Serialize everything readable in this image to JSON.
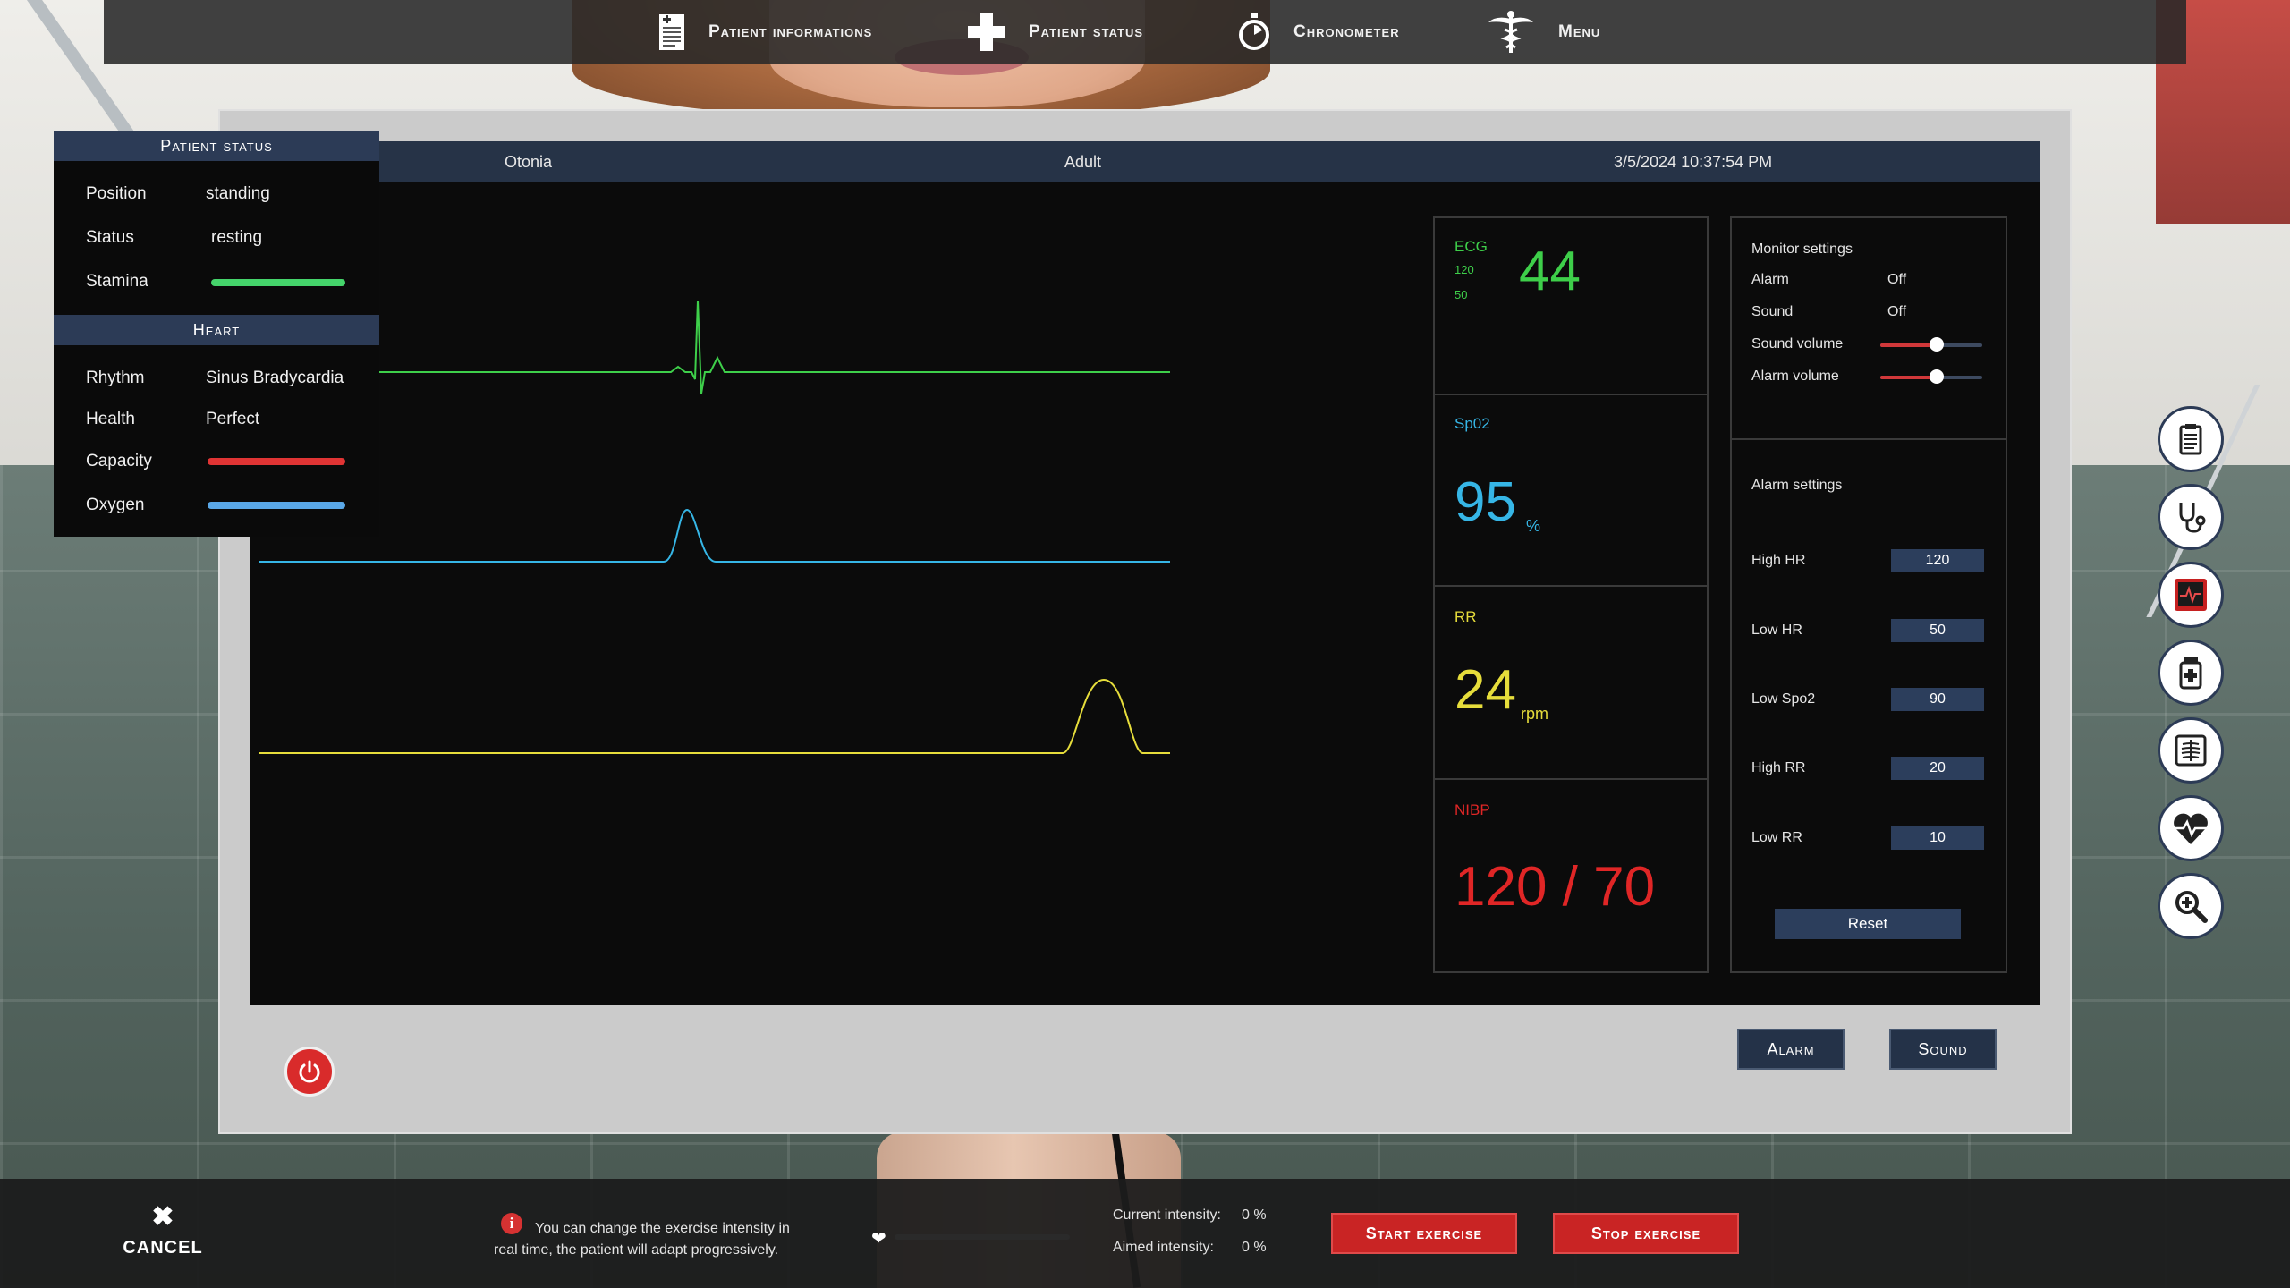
{
  "top_menu": {
    "patient_informations": "Patient informations",
    "patient_status": "Patient status",
    "chronometer": "Chronometer",
    "menu": "Menu"
  },
  "monitor": {
    "header": {
      "left": "Otonia",
      "center": "Adult",
      "right": "3/5/2024 10:37:54 PM"
    },
    "ecg": {
      "label": "ECG",
      "high": "120",
      "low": "50",
      "value": "44",
      "color": "#3ecf4a"
    },
    "spo2": {
      "label": "Sp02",
      "value": "95",
      "unit": "%",
      "color": "#36b6e6"
    },
    "rr": {
      "label": "RR",
      "value": "24",
      "unit": "rpm",
      "color": "#e6dd3b"
    },
    "nibp": {
      "label": "NIBP",
      "value": "120 / 70",
      "color": "#e02626"
    },
    "monitor_settings": {
      "title": "Monitor settings",
      "alarm_label": "Alarm",
      "alarm_value": "Off",
      "sound_label": "Sound",
      "sound_value": "Off",
      "sound_volume_label": "Sound volume",
      "sound_volume_level": 0.55,
      "alarm_volume_label": "Alarm volume",
      "alarm_volume_level": 0.55
    },
    "alarm_settings": {
      "title": "Alarm settings",
      "high_hr_label": "High HR",
      "high_hr": "120",
      "low_hr_label": "Low HR",
      "low_hr": "50",
      "low_spo2_label": "Low Spo2",
      "low_spo2": "90",
      "high_rr_label": "High RR",
      "high_rr": "20",
      "low_rr_label": "Low RR",
      "low_rr": "10",
      "reset": "Reset"
    },
    "buttons": {
      "alarm": "Alarm",
      "sound": "Sound"
    }
  },
  "patient_status": {
    "title": "Patient status",
    "position_label": "Position",
    "position": "standing",
    "status_label": "Status",
    "status": "resting",
    "stamina_label": "Stamina",
    "stamina_level": 1.0,
    "stamina_color": "#45d46b",
    "heart_title": "Heart",
    "rhythm_label": "Rhythm",
    "rhythm": "Sinus Bradycardia",
    "health_label": "Health",
    "health": "Perfect",
    "capacity_label": "Capacity",
    "capacity_level": 1.0,
    "capacity_color": "#e03434",
    "oxygen_label": "Oxygen",
    "oxygen_level": 1.0,
    "oxygen_color": "#5aa8e8"
  },
  "side_icons": [
    "clipboard-icon",
    "stethoscope-icon",
    "monitor-icon",
    "medicine-icon",
    "xray-icon",
    "heart-icon",
    "magnifier-icon"
  ],
  "bottom": {
    "cancel": "CANCEL",
    "info": "You can change the exercise intensity in real time, the patient will adapt progressively.",
    "intensity_level": 0,
    "current_intensity_label": "Current intensity:",
    "current_intensity": "0 %",
    "aimed_intensity_label": "Aimed intensity:",
    "aimed_intensity": "0 %",
    "start_exercise": "Start exercise",
    "stop_exercise": "Stop exercise"
  }
}
